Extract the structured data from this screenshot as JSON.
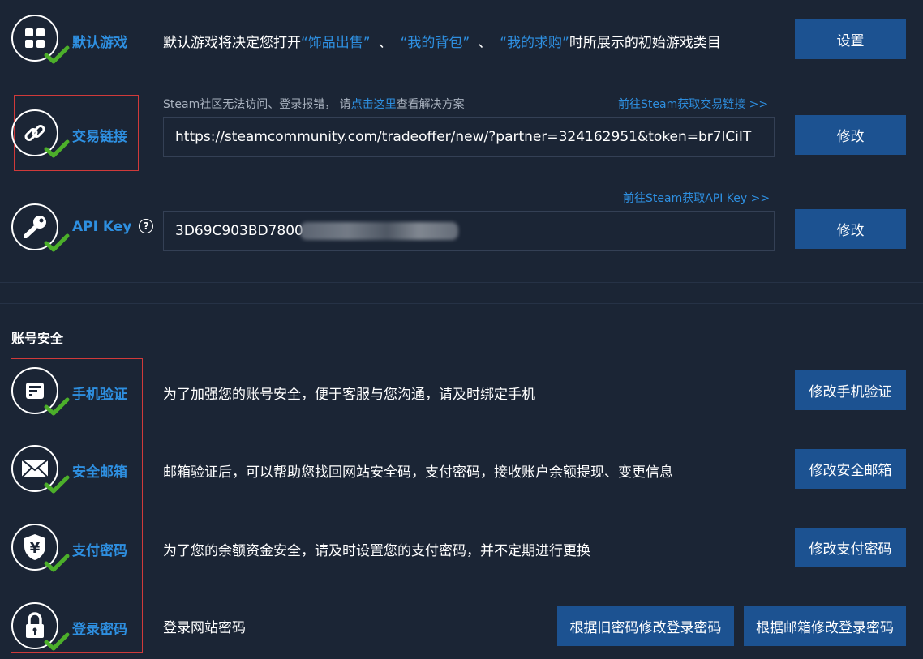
{
  "default_game": {
    "label": "默认游戏",
    "desc_prefix": "默认游戏将决定您打开",
    "hl1": "“饰品出售”",
    "sep1": "、",
    "hl2": "“我的背包”",
    "sep2": "、",
    "hl3": "“我的求购”",
    "desc_suffix": "时所展示的初始游戏类目",
    "button": "设置"
  },
  "trade_link": {
    "label": "交易链接",
    "hint_prefix": "Steam社区无法访问、登录报错， 请",
    "hint_link": "点击这里",
    "hint_suffix": "查看解决方案",
    "external_link": "前往Steam获取交易链接 >>",
    "value": "https://steamcommunity.com/tradeoffer/new/?partner=324162951&token=br7lCiIT",
    "button": "修改"
  },
  "api_key": {
    "label": "API Key",
    "help": "?",
    "external_link": "前往Steam获取API Key >>",
    "value": "3D69C903BD7800",
    "button": "修改"
  },
  "security": {
    "title": "账号安全",
    "phone": {
      "label": "手机验证",
      "desc": "为了加强您的账号安全，便于客服与您沟通，请及时绑定手机",
      "button": "修改手机验证"
    },
    "email": {
      "label": "安全邮箱",
      "desc": "邮箱验证后，可以帮助您找回网站安全码，支付密码，接收账户余额提现、变更信息",
      "button": "修改安全邮箱"
    },
    "pay": {
      "label": "支付密码",
      "desc": "为了您的余额资金安全，请及时设置您的支付密码，并不定期进行更换",
      "button": "修改支付密码"
    },
    "login": {
      "label": "登录密码",
      "desc": "登录网站密码",
      "button_old": "根据旧密码修改登录密码",
      "button_email": "根据邮箱修改登录密码"
    }
  },
  "colors": {
    "background": "#1b2535",
    "accent": "#2e8fe0",
    "button": "#1c5291",
    "check": "#4caf2a",
    "highlight_box": "#d03a3a"
  }
}
